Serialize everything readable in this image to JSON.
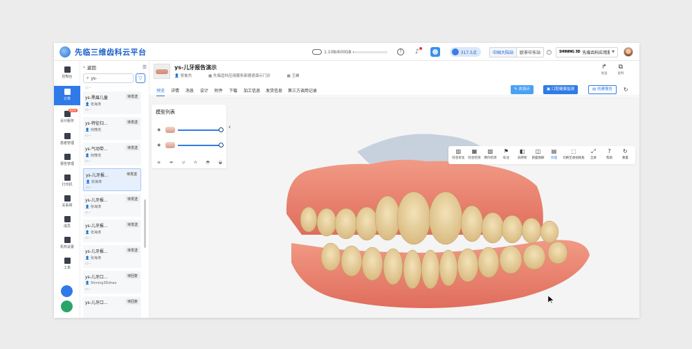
{
  "app": {
    "title": "先临三维齿科云平台"
  },
  "header": {
    "storage_text": "1.10B/600GB",
    "storage_used_pct": 1,
    "points": "317.5点",
    "regions": [
      "中国大陆站",
      "欧非中东站"
    ],
    "org_logo": "SHINING 3D",
    "org_name": "先临齿科应用服..."
  },
  "nav": {
    "items": [
      {
        "label": "控制台"
      },
      {
        "label": "订单"
      },
      {
        "label": "设计服务",
        "badge": "NEW"
      },
      {
        "label": "患者管理"
      },
      {
        "label": "报告管理"
      },
      {
        "label": "打印机"
      },
      {
        "label": "关系网"
      },
      {
        "label": "成员"
      },
      {
        "label": "机构设置"
      },
      {
        "label": "工单"
      }
    ]
  },
  "list": {
    "back_label": "返回",
    "search_value": "ys-",
    "top_file": "-",
    "cards": [
      {
        "name": "ys-黑眉儿童",
        "status": "待发送",
        "user": "张海涛",
        "file": "-"
      },
      {
        "name": "ys-特征归...",
        "status": "待发送",
        "user": "倪懂浩",
        "file": "-"
      },
      {
        "name": "ys-气动带...",
        "status": "待发送",
        "user": "倪懂浩",
        "file": "-"
      },
      {
        "name": "ys-儿牙报...",
        "status": "待发送",
        "user": "张海涛",
        "file": "-"
      },
      {
        "name": "ys-儿牙报...",
        "status": "待发送",
        "user": "张海涛",
        "file": "-"
      },
      {
        "name": "ys-儿牙报...",
        "status": "待发送",
        "user": "张海涛",
        "file": "-"
      },
      {
        "name": "ys-儿牙报...",
        "status": "待发送",
        "user": "张海涛",
        "file": "-"
      },
      {
        "name": "ys-儿牙口...",
        "status": "待回复",
        "user": "Shining3Dzhao",
        "file": "-"
      },
      {
        "name": "ys-儿牙口...",
        "status": "待回复",
        "user": "",
        "file": ""
      }
    ]
  },
  "order": {
    "title": "ys-儿牙报告演示",
    "user": "吴俊杰",
    "clinic": "先临齿科应用服务部德语演示门诊",
    "doctor": "王峰"
  },
  "actions": [
    {
      "label": "发送"
    },
    {
      "label": "复制"
    }
  ],
  "tabs": [
    "预览",
    "详情",
    "消息",
    "设计",
    "附件",
    "下载",
    "加工信息",
    "发货信息",
    "第三方调用记录"
  ],
  "buttons": {
    "design": "去设计",
    "health": "口腔健康监测",
    "report": "创建报告"
  },
  "model_list": {
    "title": "模型列表",
    "rows": [
      {
        "opacity": 100
      },
      {
        "opacity": 100
      }
    ]
  },
  "toolbar": [
    {
      "label": "咬合优化",
      "icon": "occlusion-icon"
    },
    {
      "label": "咬合检测",
      "icon": "occlusion-check-icon"
    },
    {
      "label": "倒凹检测",
      "icon": "undercut-icon"
    },
    {
      "label": "标注",
      "icon": "marker-icon"
    },
    {
      "label": "去牌倾",
      "icon": "tilt-icon"
    },
    {
      "label": "剖面图解",
      "icon": "section-icon"
    },
    {
      "label": "纹理",
      "icon": "texture-icon"
    },
    {
      "label": "切换至透视视角",
      "icon": "perspective-icon"
    },
    {
      "label": "全屏",
      "icon": "fullscreen-icon"
    },
    {
      "label": "帮助",
      "icon": "help-icon"
    },
    {
      "label": "重置",
      "icon": "reset-icon"
    }
  ],
  "colors": {
    "accent": "#2f7ae8",
    "brand": "#1a5fc8",
    "gum": "#e8806e",
    "tooth": "#e9d3a3"
  }
}
